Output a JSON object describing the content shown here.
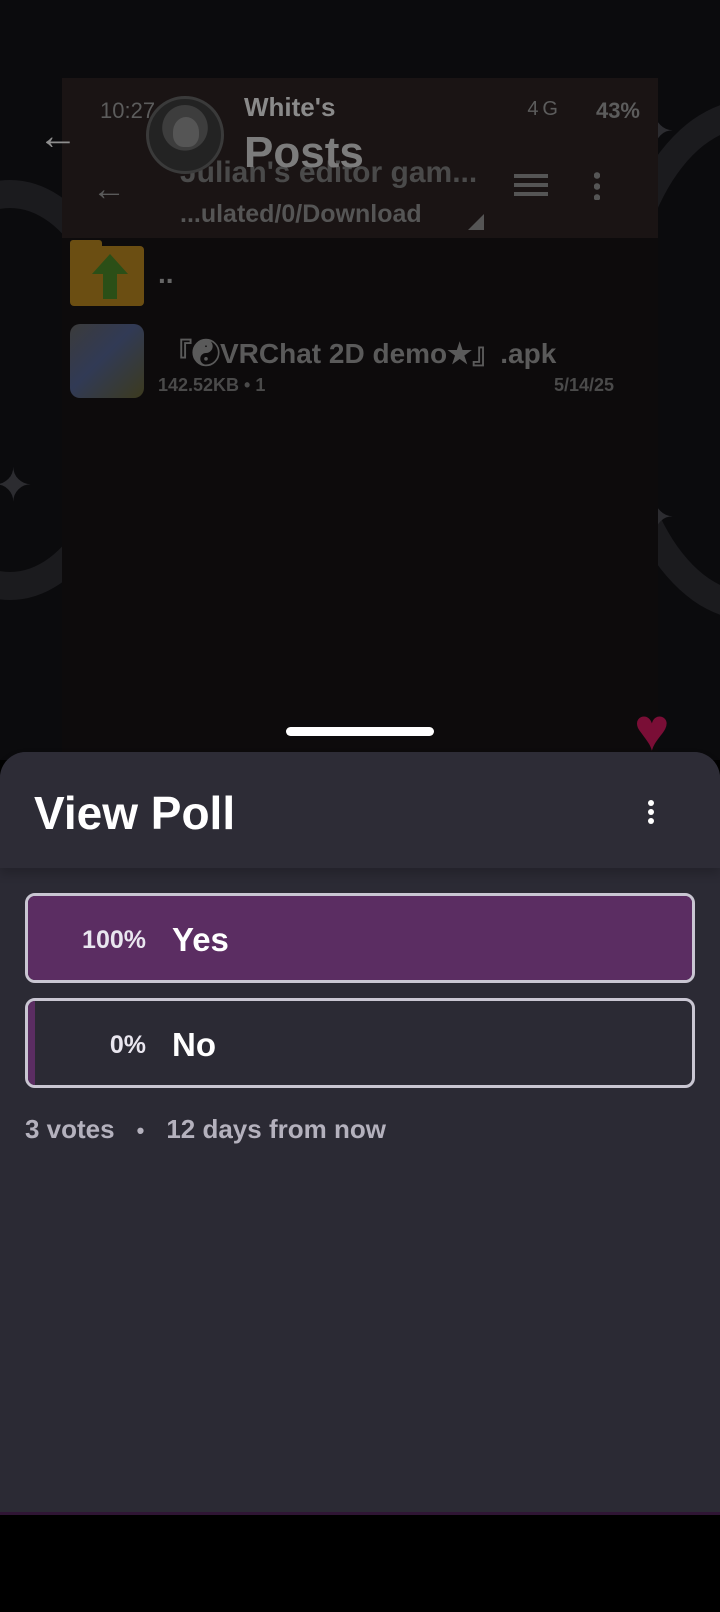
{
  "background_screenshot": {
    "status_time": "10:27",
    "status_signal": "4G",
    "status_battery": "43%",
    "title": "Julian's editor gam...",
    "path": "...ulated/0/Download",
    "up_dir": "..",
    "file_name": "『☯VRChat 2D demo★』.apk",
    "file_meta": "142.52KB   • 1",
    "file_date": "5/14/25"
  },
  "header": {
    "owner": "White's",
    "page_title": "Posts"
  },
  "icons": {
    "back": "arrow-left",
    "more": "more-vertical",
    "favorite": "heart",
    "heart_color": "#7a0e36"
  },
  "sheet": {
    "title": "View Poll"
  },
  "poll": {
    "options": [
      {
        "label": "Yes",
        "percent_text": "100%",
        "fraction": 1.0
      },
      {
        "label": "No",
        "percent_text": "0%",
        "fraction": 0.0
      }
    ],
    "votes": "3 votes",
    "separator": "•",
    "time_left": "12 days from now",
    "fill_color": "#5b2d62",
    "accent_border": "#c9c6d2"
  }
}
